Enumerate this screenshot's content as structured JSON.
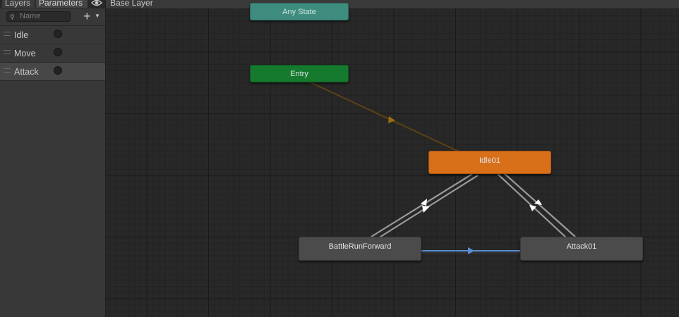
{
  "panel": {
    "tabs": [
      "Layers",
      "Parameters"
    ],
    "search_placeholder": "Name",
    "add_label": "+",
    "params": [
      {
        "name": "Idle",
        "type": "trigger",
        "selected": false
      },
      {
        "name": "Move",
        "type": "trigger",
        "selected": false
      },
      {
        "name": "Attack",
        "type": "trigger",
        "selected": true
      }
    ]
  },
  "breadcrumb": "Base Layer",
  "states": {
    "any": "Any State",
    "entry": "Entry",
    "idle": "Idle01",
    "run": "BattleRunForward",
    "attack": "Attack01"
  },
  "colors": {
    "any_state": "#3e8c7e",
    "entry": "#157a2e",
    "default_state": "#d8701a",
    "state": "#4b4b4b",
    "entry_transition": "#5a4216",
    "transition": "#b0b0b0",
    "selected_transition": "#5b8fd6"
  },
  "icons": {
    "eye": "eye-icon",
    "search": "search-icon",
    "add": "plus-icon",
    "dropdown": "chevron-down-icon",
    "handle": "drag-handle-icon"
  }
}
